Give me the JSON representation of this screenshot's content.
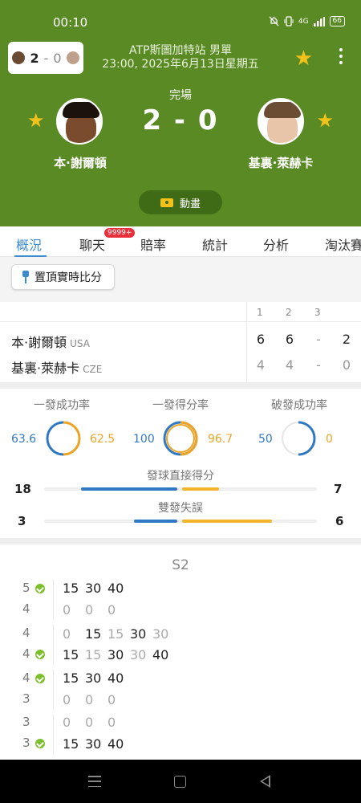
{
  "status_bar": {
    "time": "00:10",
    "icons": [
      "mute-icon",
      "vibrate-icon",
      "signal-icon",
      "battery-icon"
    ],
    "signal_text": "4G",
    "battery": "66"
  },
  "header": {
    "mini_score": {
      "home": "2",
      "sep": "-",
      "away": "0"
    },
    "tournament": "ATP斯圖加特站 男單",
    "datetime": "23:00, 2025年6月13日星期五",
    "match_status": "完場",
    "score": "2 - 0",
    "animation_label": "動畫"
  },
  "players": [
    {
      "name": "本·謝爾頓",
      "country": "USA",
      "sets": [
        "6",
        "6",
        "-",
        "2"
      ]
    },
    {
      "name": "基裏·萊赫卡",
      "country": "CZE",
      "sets": [
        "4",
        "4",
        "-",
        "0"
      ]
    }
  ],
  "set_headers": [
    "1",
    "2",
    "3"
  ],
  "tabs": [
    {
      "label": "概況",
      "active": true
    },
    {
      "label": "聊天",
      "badge": "9999+"
    },
    {
      "label": "賠率"
    },
    {
      "label": "統計"
    },
    {
      "label": "分析"
    },
    {
      "label": "淘汰賽"
    }
  ],
  "pin_button": "置頂實時比分",
  "stats": {
    "rings": [
      {
        "title": "一發成功率",
        "home": "63.6",
        "away": "62.5"
      },
      {
        "title": "一發得分率",
        "home": "100",
        "away": "96.7"
      },
      {
        "title": "破發成功率",
        "home": "50",
        "away": "0"
      }
    ],
    "bars": [
      {
        "title": "發球直接得分",
        "home": "18",
        "away": "7"
      },
      {
        "title": "雙發失誤",
        "home": "3",
        "away": "6"
      }
    ]
  },
  "colors": {
    "home": "#2f79c4",
    "away": "#eda323",
    "header_green": "#5a8a24",
    "active_tab": "#3d8ccf"
  },
  "point_by_point": {
    "set_title": "S2",
    "games": [
      {
        "top_score": "5",
        "bottom_score": "4",
        "server": "top",
        "top_points": [
          "15",
          "30",
          "40"
        ],
        "bottom_points": [
          "0",
          "0",
          "0"
        ]
      },
      {
        "top_score": "4",
        "bottom_score": "4",
        "server": "bottom",
        "top_points": [
          "0",
          "15",
          "15",
          "30",
          "30"
        ],
        "bottom_points": [
          "15",
          "15",
          "30",
          "30",
          "40"
        ]
      },
      {
        "top_score": "4",
        "bottom_score": "3",
        "server": "top",
        "top_points": [
          "15",
          "30",
          "40"
        ],
        "bottom_points": [
          "0",
          "0",
          "0"
        ]
      },
      {
        "top_score": "3",
        "bottom_score": "3",
        "server": "bottom",
        "top_points": [
          "0",
          "0",
          "0"
        ],
        "bottom_points": [
          "15",
          "30",
          "40"
        ]
      }
    ]
  }
}
